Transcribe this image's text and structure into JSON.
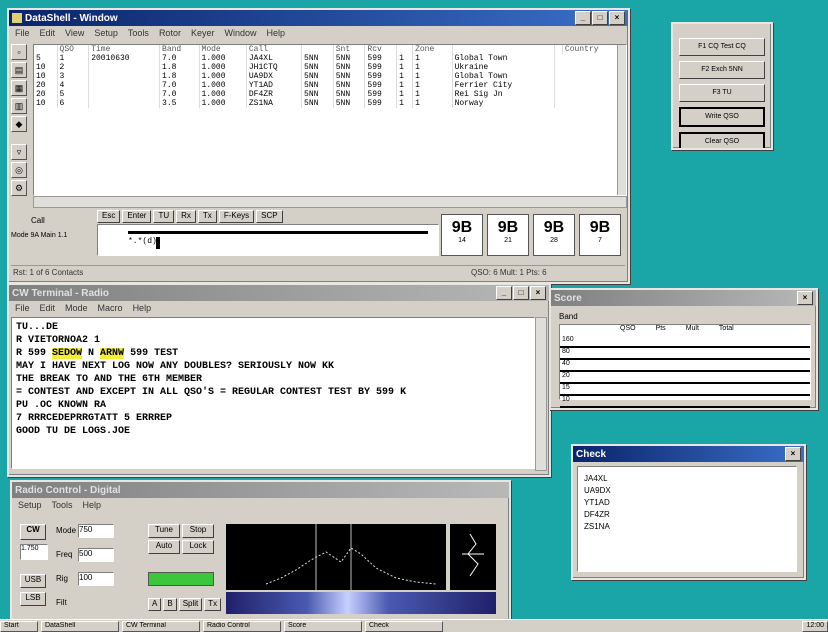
{
  "log_window": {
    "title": "DataShell - Window",
    "menu": [
      "File",
      "Edit",
      "View",
      "Setup",
      "Tools",
      "Rotor",
      "Keyer",
      "Window",
      "Help"
    ],
    "headers": [
      "",
      "QSO",
      "Time",
      "Band",
      "Mode",
      "Call",
      "",
      "Snt",
      "Rcv",
      "",
      "Zone",
      "",
      "",
      "Country"
    ],
    "rows": [
      [
        "5",
        "1",
        "20010630",
        "7.0",
        "1.000",
        "JA4XL",
        "5NN",
        "5NN",
        "599",
        "1",
        "1",
        "Global Town"
      ],
      [
        "10",
        "2",
        "",
        "1.8",
        "1.000",
        "JH1CTQ",
        "5NN",
        "5NN",
        "599",
        "1",
        "1",
        "Ukraine"
      ],
      [
        "10",
        "3",
        "",
        "1.8",
        "1.000",
        "UA9DX",
        "5NN",
        "5NN",
        "599",
        "1",
        "1",
        "Global Town"
      ],
      [
        "20",
        "4",
        "",
        "7.0",
        "1.000",
        "YT1AD",
        "5NN",
        "5NN",
        "599",
        "1",
        "1",
        "Ferrier City"
      ],
      [
        "20",
        "5",
        "",
        "7.0",
        "1.000",
        "DF4ZR",
        "5NN",
        "5NN",
        "599",
        "1",
        "1",
        "Rei Sig Jn"
      ],
      [
        "10",
        "6",
        "",
        "3.5",
        "1.000",
        "ZS1NA",
        "5NN",
        "5NN",
        "599",
        "1",
        "1",
        "Norway"
      ]
    ],
    "entry_label_1": "Call",
    "entry_label_2": "Mode 9A Main 1.1",
    "entry_value": "*.*(d)",
    "entry_buttons": [
      "Esc",
      "Enter",
      "TU",
      "Rx",
      "Tx",
      "F-Keys",
      "SCP"
    ],
    "status_left": "Rst: 1 of 6 Contacts",
    "status_right": "QSO: 6 Mult: 1 Pts: 6",
    "bandmap": [
      "9B",
      "9B",
      "9B",
      "9B"
    ],
    "bandmap_labels": [
      "14",
      "21",
      "28",
      "7"
    ]
  },
  "terminal_window": {
    "title": "CW Terminal - Radio",
    "menu": [
      "File",
      "Edit",
      "Mode",
      "Macro",
      "Help"
    ],
    "lines": [
      {
        "pre": " TU...DE",
        "hl": "",
        "mid": "",
        "hl2": "",
        "post": ""
      },
      {
        "pre": "R VIETORNOA2 1",
        "hl": "",
        "mid": "",
        "hl2": "",
        "post": ""
      },
      {
        "pre": "R  599  ",
        "hl": "SEDOW",
        "mid": " N ",
        "hl2": "ARNW",
        "post": "  599   TEST"
      },
      {
        "pre": " MAY I HAVE NEXT LOG NOW  ANY DOUBLES? SERIOUSLY NOW KK",
        "hl": "",
        "mid": "",
        "hl2": "",
        "post": ""
      },
      {
        "pre": "THE BREAK TO AND THE 6TH MEMBER",
        "hl": "",
        "mid": "",
        "hl2": "",
        "post": ""
      },
      {
        "pre": "= CONTEST AND EXCEPT IN ALL QSO'S = REGULAR CONTEST TEST BY 599 K",
        "hl": "",
        "mid": "",
        "hl2": "",
        "post": ""
      },
      {
        "pre": "PU  .OC KNOWN RA",
        "hl": "",
        "mid": "",
        "hl2": "",
        "post": ""
      },
      {
        "pre": "  7 RRRCEDEPRRGTATT 5 ERRREP",
        "hl": "",
        "mid": "",
        "hl2": "",
        "post": ""
      },
      {
        "pre": "GOOD TU DE LOGS.JOE",
        "hl": "",
        "mid": "",
        "hl2": "",
        "post": ""
      }
    ]
  },
  "radio_window": {
    "title": "Radio Control - Digital",
    "menu": [
      "Setup",
      "Tools",
      "Help"
    ],
    "mode_label": "CW",
    "freq": "1.750",
    "labels": [
      "Mode",
      "Freq",
      "Rig",
      "Filt"
    ],
    "value_1": "750",
    "value_2": "500",
    "value_3": "100",
    "buttons": [
      "CW",
      "USB",
      "LSB",
      "Tune",
      "Stop",
      "Auto",
      "Lock"
    ],
    "footer_buttons": [
      "A",
      "B",
      "Split",
      "Tx"
    ]
  },
  "macro_panel": {
    "buttons": [
      "F1 CQ Test CQ",
      "F2 Exch 5NN",
      "F3 TU",
      "Write QSO",
      "Clear QSO"
    ]
  },
  "stats_window": {
    "title": "Score",
    "header": "Band",
    "cols": [
      "QSO",
      "Pts",
      "Mult",
      "Total"
    ],
    "rows": [
      "160",
      "80",
      "40",
      "20",
      "15",
      "10"
    ]
  },
  "list_window": {
    "title": "Check",
    "items": [
      "JA4XL",
      "UA9DX",
      "YT1AD",
      "DF4ZR",
      "ZS1NA"
    ]
  },
  "taskbar": {
    "items": [
      "Start",
      "DataShell",
      "CW Terminal",
      "Radio Control",
      "Score",
      "Check"
    ],
    "clock": "12:00"
  },
  "colors": {
    "desktop": "#1aa6a6",
    "title_active": "#0a246a",
    "highlight": "#f4ee3a"
  }
}
